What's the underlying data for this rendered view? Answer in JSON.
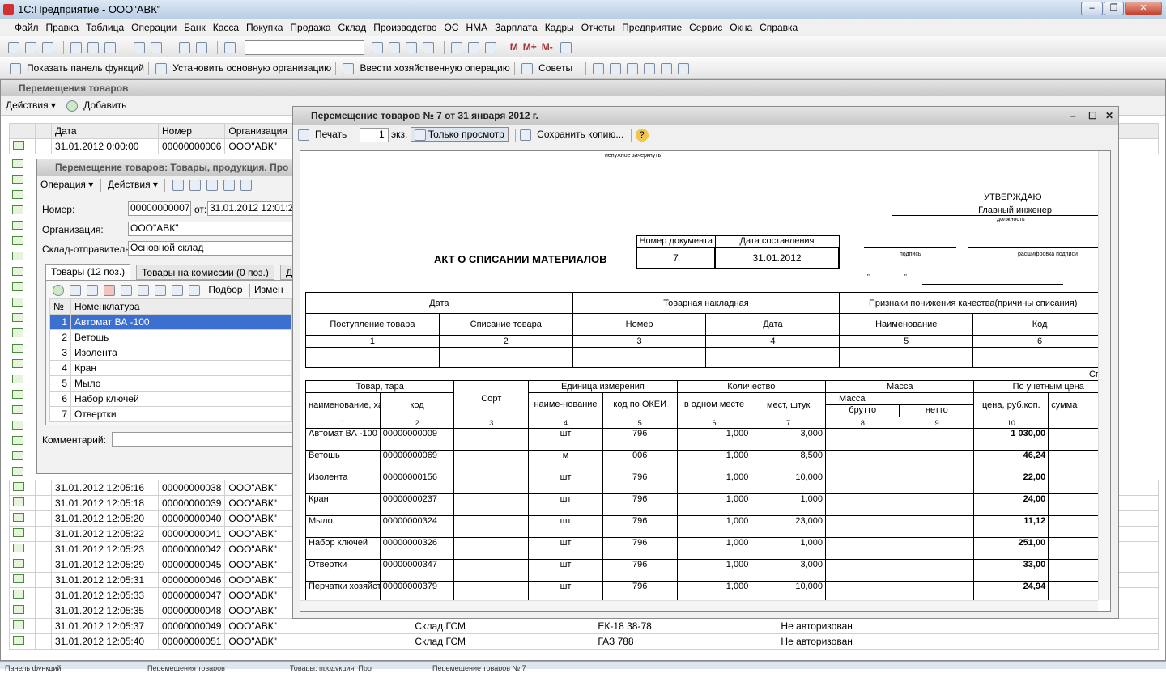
{
  "app": {
    "title": "1С:Предприятие - ООО\"АВК\""
  },
  "menu": [
    "Файл",
    "Правка",
    "Таблица",
    "Операции",
    "Банк",
    "Касса",
    "Покупка",
    "Продажа",
    "Склад",
    "Производство",
    "ОС",
    "НМА",
    "Зарплата",
    "Кадры",
    "Отчеты",
    "Предприятие",
    "Сервис",
    "Окна",
    "Справка"
  ],
  "toolbar2": {
    "show_panel": "Показать панель функций",
    "set_org": "Установить основную организацию",
    "enter_op": "Ввести хозяйственную операцию",
    "tips": "Советы"
  },
  "list": {
    "title": "Перемещения товаров",
    "actions": "Действия",
    "add": "Добавить",
    "cols": [
      "Дата",
      "Номер",
      "Организация"
    ],
    "first_row": {
      "date": "31.01.2012 0:00:00",
      "num": "00000000006",
      "org": "ООО\"АВК\""
    },
    "rows": [
      {
        "date": "31.01.2012 12:05:16",
        "num": "00000000038",
        "org": "ООО\"АВК\"",
        "wh": "",
        "car": "",
        "st": ""
      },
      {
        "date": "31.01.2012 12:05:18",
        "num": "00000000039",
        "org": "ООО\"АВК\"",
        "wh": "",
        "car": "",
        "st": ""
      },
      {
        "date": "31.01.2012 12:05:20",
        "num": "00000000040",
        "org": "ООО\"АВК\"",
        "wh": "",
        "car": "",
        "st": ""
      },
      {
        "date": "31.01.2012 12:05:22",
        "num": "00000000041",
        "org": "ООО\"АВК\"",
        "wh": "",
        "car": "",
        "st": ""
      },
      {
        "date": "31.01.2012 12:05:23",
        "num": "00000000042",
        "org": "ООО\"АВК\"",
        "wh": "",
        "car": "",
        "st": ""
      },
      {
        "date": "31.01.2012 12:05:29",
        "num": "00000000045",
        "org": "ООО\"АВК\"",
        "wh": "",
        "car": "",
        "st": ""
      },
      {
        "date": "31.01.2012 12:05:31",
        "num": "00000000046",
        "org": "ООО\"АВК\"",
        "wh": "",
        "car": "",
        "st": ""
      },
      {
        "date": "31.01.2012 12:05:33",
        "num": "00000000047",
        "org": "ООО\"АВК\"",
        "wh": "",
        "car": "",
        "st": ""
      },
      {
        "date": "31.01.2012 12:05:35",
        "num": "00000000048",
        "org": "ООО\"АВК\"",
        "wh": "",
        "car": "",
        "st": ""
      },
      {
        "date": "31.01.2012 12:05:37",
        "num": "00000000049",
        "org": "ООО\"АВК\"",
        "wh": "Склад ГСМ",
        "car": "ЕК-18 38-78",
        "st": "Не авторизован"
      },
      {
        "date": "31.01.2012 12:05:40",
        "num": "00000000051",
        "org": "ООО\"АВК\"",
        "wh": "Склад ГСМ",
        "car": "ГАЗ 788",
        "st": "Не авторизован"
      }
    ]
  },
  "form": {
    "title": "Перемещение товаров: Товары, продукция. Про",
    "operation": "Операция",
    "actions": "Действия",
    "number_label": "Номер:",
    "number": "00000000007",
    "from_label": "от:",
    "date": "31.01.2012 12:01:22",
    "org_label": "Организация:",
    "org": "ООО\"АВК\"",
    "wh_label": "Склад-отправитель:",
    "wh": "Основной склад",
    "tab1": "Товары (12 поз.)",
    "tab2": "Товары на комиссии (0 поз.)",
    "tab3": "Д",
    "pick": "Подбор",
    "change": "Измен",
    "col_no": "№",
    "col_nom": "Номенклатура",
    "items": [
      "Автомат ВА -100",
      "Ветошь",
      "Изолента",
      "Кран",
      "Мыло",
      "Набор ключей",
      "Отвертки"
    ],
    "comment_label": "Комментарий:"
  },
  "print": {
    "title": "Перемещение товаров № 7 от 31 января 2012 г.",
    "print": "Печать",
    "copies": "1",
    "ekz": "экз.",
    "view_only": "Только просмотр",
    "save_copy": "Сохранить копию...",
    "small_note": "ненужное зачеркнуть",
    "approve": "УТВЕРЖДАЮ",
    "chief": "Главный инженер",
    "position": "должность",
    "sign": "подпись",
    "sign_decode": "расшифровка подписи",
    "quote": "\"",
    "act_title": "АКТ О СПИСАНИИ МАТЕРИАЛОВ",
    "doc_num_h": "Номер документа",
    "doc_date_h": "Дата составления",
    "doc_num": "7",
    "doc_date": "31.01.2012",
    "t1": {
      "h_date": "Дата",
      "h_inv": "Товарная накладная",
      "h_sign": "Признаки понижения качества(причины списания)",
      "h_in": "Поступление товара",
      "h_out": "Списание товара",
      "h_num": "Номер",
      "h_d": "Дата",
      "h_name": "Наименование",
      "h_code": "Код",
      "n": [
        "1",
        "2",
        "3",
        "4",
        "5",
        "6"
      ]
    },
    "t2": {
      "sp": "Сп",
      "goods": "Товар, тара",
      "name": "наименование, характеристика",
      "code": "код",
      "sort": "Сорт",
      "unit": "Единица измерения",
      "unit_name": "наиме-нование",
      "okei": "код по ОКЕИ",
      "qty": "Количество",
      "one": "в одном месте",
      "places": "мест, штук",
      "mass": "Масса",
      "mass2": "Масса",
      "brutto": "брутто",
      "netto": "нетто",
      "acc": "По учетным цена",
      "price": "цена, руб.коп.",
      "sum": "сумма",
      "n": [
        "1",
        "2",
        "3",
        "4",
        "5",
        "6",
        "7",
        "8",
        "9",
        "10"
      ],
      "rows": [
        {
          "name": "Автомат ВА -100",
          "code": "00000000009",
          "unit": "шт",
          "okei": "796",
          "one": "1,000",
          "pl": "3,000",
          "price": "1 030,00"
        },
        {
          "name": "Ветошь",
          "code": "00000000069",
          "unit": "м",
          "okei": "006",
          "one": "1,000",
          "pl": "8,500",
          "price": "46,24"
        },
        {
          "name": "Изолента",
          "code": "00000000156",
          "unit": "шт",
          "okei": "796",
          "one": "1,000",
          "pl": "10,000",
          "price": "22,00"
        },
        {
          "name": "Кран",
          "code": "00000000237",
          "unit": "шт",
          "okei": "796",
          "one": "1,000",
          "pl": "1,000",
          "price": "24,00"
        },
        {
          "name": "Мыло",
          "code": "00000000324",
          "unit": "шт",
          "okei": "796",
          "one": "1,000",
          "pl": "23,000",
          "price": "11,12"
        },
        {
          "name": "Набор ключей",
          "code": "00000000326",
          "unit": "шт",
          "okei": "796",
          "one": "1,000",
          "pl": "1,000",
          "price": "251,00"
        },
        {
          "name": "Отвертки",
          "code": "00000000347",
          "unit": "шт",
          "okei": "796",
          "one": "1,000",
          "pl": "3,000",
          "price": "33,00"
        },
        {
          "name": "Перчатки хозяйственные",
          "code": "00000000379",
          "unit": "шт",
          "okei": "796",
          "one": "1,000",
          "pl": "10,000",
          "price": "24,94"
        }
      ]
    }
  },
  "taskbar": [
    "Панель функций",
    "Перемещения товаров",
    "Товары, продукция. Про",
    "Перемещение товаров № 7"
  ]
}
